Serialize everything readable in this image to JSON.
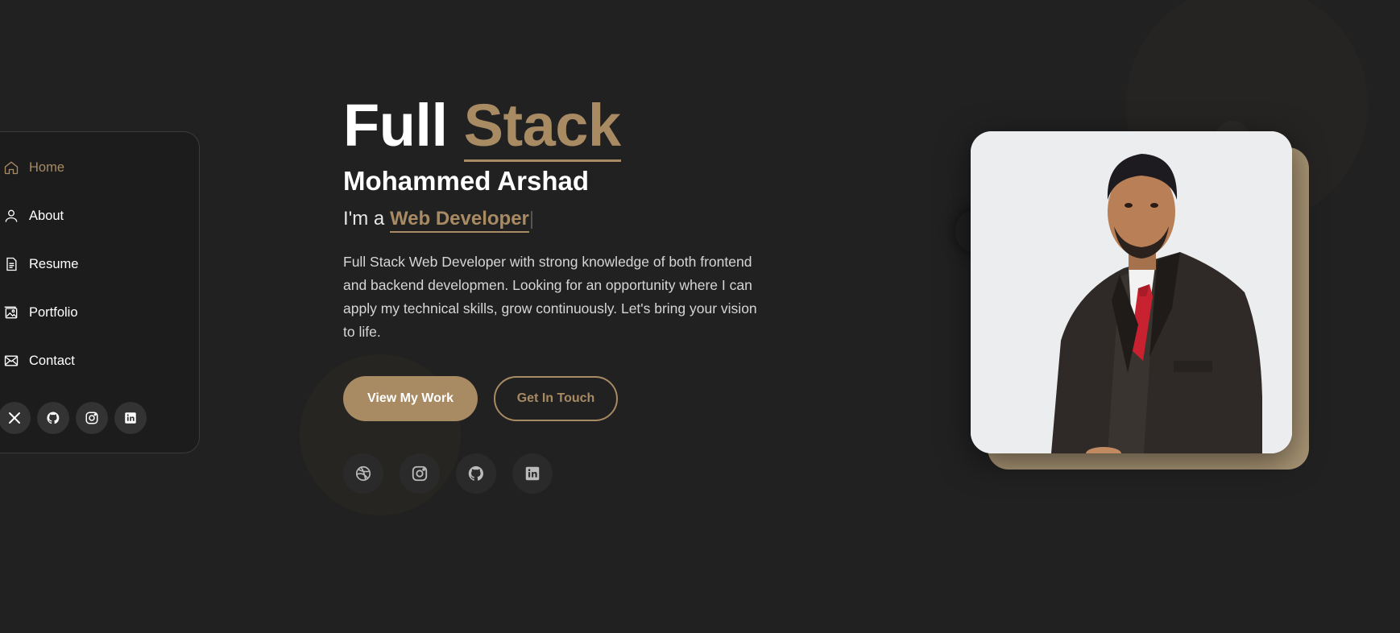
{
  "sidebar": {
    "items": [
      {
        "label": "Home",
        "icon": "home-icon",
        "active": true
      },
      {
        "label": "About",
        "icon": "user-icon",
        "active": false
      },
      {
        "label": "Resume",
        "icon": "document-icon",
        "active": false
      },
      {
        "label": "Portfolio",
        "icon": "image-icon",
        "active": false
      },
      {
        "label": "Contact",
        "icon": "envelope-icon",
        "active": false
      }
    ],
    "social": [
      "x-icon",
      "github-icon",
      "instagram-icon",
      "linkedin-icon"
    ]
  },
  "hero": {
    "title_plain": "Full",
    "title_accent": "Stack",
    "name": "Mohammed Arshad",
    "role_prefix": "I'm a",
    "role_typed": "Web Developer",
    "description": "Full Stack Web Developer with strong knowledge of both frontend and backend developmen. Looking for an opportunity where I can apply my technical skills, grow continuously. Let's bring your vision to life.",
    "primary_button": "View My Work",
    "secondary_button": "Get In Touch",
    "social": [
      "dribbble-icon",
      "instagram-icon",
      "github-icon",
      "linkedin-icon"
    ]
  },
  "colors": {
    "background": "#212121",
    "accent": "#a88a63",
    "photo_frame": "#a89474"
  }
}
